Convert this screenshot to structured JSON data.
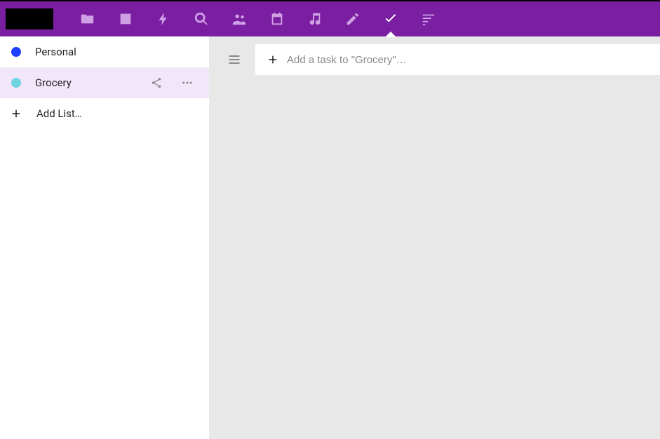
{
  "topnav": {
    "items": [
      {
        "name": "files",
        "icon": "folder-icon"
      },
      {
        "name": "photos",
        "icon": "image-icon"
      },
      {
        "name": "activity",
        "icon": "bolt-icon"
      },
      {
        "name": "talk",
        "icon": "search-circle-icon"
      },
      {
        "name": "contacts",
        "icon": "people-icon"
      },
      {
        "name": "calendar",
        "icon": "calendar-icon"
      },
      {
        "name": "music",
        "icon": "music-note-icon"
      },
      {
        "name": "notes",
        "icon": "pencil-icon"
      },
      {
        "name": "tasks",
        "icon": "check-icon",
        "active": true
      },
      {
        "name": "sort",
        "icon": "sort-lines-icon"
      }
    ]
  },
  "sidebar": {
    "lists": [
      {
        "label": "Personal",
        "color": "#1e3fff",
        "selected": false
      },
      {
        "label": "Grocery",
        "color": "#6fd4e2",
        "selected": true
      }
    ],
    "add_list_label": "Add List…"
  },
  "main": {
    "task_input_placeholder": "Add a task to \"Grocery\"…"
  }
}
